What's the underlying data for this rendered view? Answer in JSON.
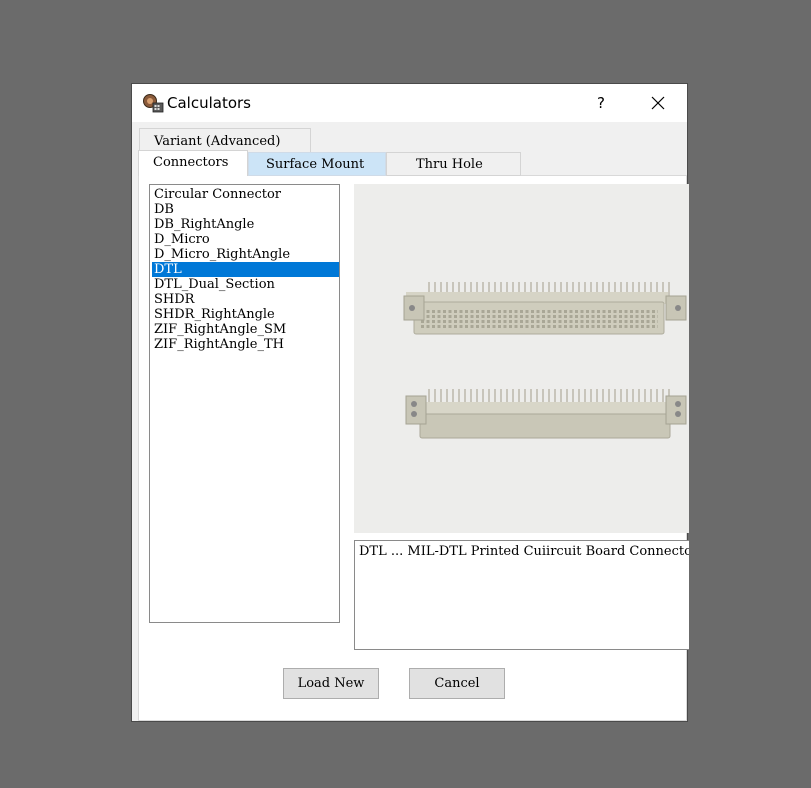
{
  "window": {
    "title": "Calculators",
    "help_label": "?"
  },
  "tabs": {
    "variant": "Variant (Advanced)",
    "connectors": "Connectors",
    "surface_mount": "Surface Mount",
    "thru_hole": "Thru Hole"
  },
  "list": {
    "items": [
      "Circular Connector",
      "DB",
      "DB_RightAngle",
      "D_Micro",
      "D_Micro_RightAngle",
      "DTL",
      "DTL_Dual_Section",
      "SHDR",
      "SHDR_RightAngle",
      "ZIF_RightAngle_SM",
      "ZIF_RightAngle_TH"
    ],
    "selected": "DTL"
  },
  "description": "DTL ... MIL-DTL Printed Cuiircuit Board Connector",
  "buttons": {
    "load_new": "Load New",
    "cancel": "Cancel"
  },
  "colors": {
    "selection": "#0078d7",
    "active_tab": "#cce4f7",
    "backdrop": "#6b6b6b"
  }
}
